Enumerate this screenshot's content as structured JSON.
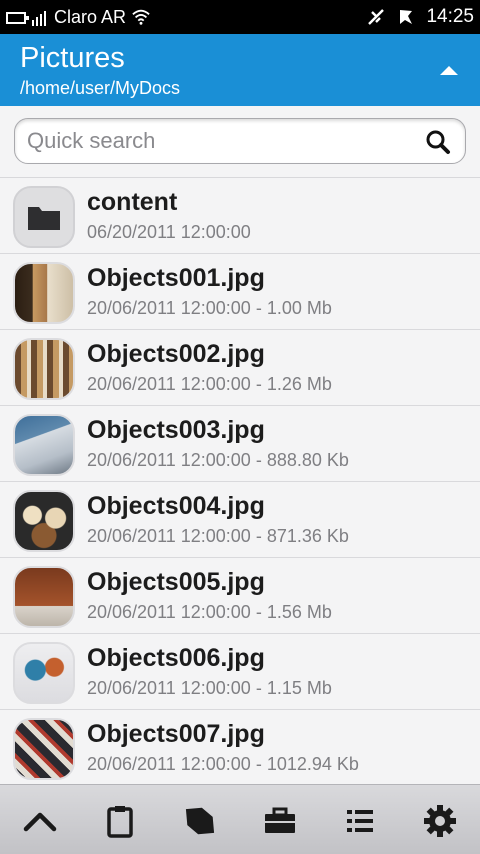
{
  "status_bar": {
    "carrier": "Claro AR",
    "time": "14:25",
    "icons": [
      "battery-icon",
      "signal-icon",
      "wifi-icon",
      "usb-icon",
      "notification-icon"
    ]
  },
  "header": {
    "title": "Pictures",
    "path": "/home/user/MyDocs",
    "accent": "#1a8fd6"
  },
  "search": {
    "placeholder": "Quick search",
    "value": ""
  },
  "files": [
    {
      "name": "content",
      "meta": "06/20/2011 12:00:00",
      "kind": "folder"
    },
    {
      "name": "Objects001.jpg",
      "meta": "20/06/2011 12:00:00 - 1.00 Mb",
      "kind": "image",
      "colors": [
        "#3a2a1c",
        "#b07a48",
        "#efe4cf"
      ]
    },
    {
      "name": "Objects002.jpg",
      "meta": "20/06/2011 12:00:00 - 1.26 Mb",
      "kind": "image",
      "colors": [
        "#6b4a2e",
        "#c59a63",
        "#e8dcc8"
      ]
    },
    {
      "name": "Objects003.jpg",
      "meta": "20/06/2011 12:00:00 - 888.80 Kb",
      "kind": "image",
      "colors": [
        "#3f6f9a",
        "#cfd6dd",
        "#7e8a95"
      ]
    },
    {
      "name": "Objects004.jpg",
      "meta": "20/06/2011 12:00:00 - 871.36 Kb",
      "kind": "image",
      "colors": [
        "#2a2a2a",
        "#e8d6b5",
        "#8a5a32"
      ]
    },
    {
      "name": "Objects005.jpg",
      "meta": "20/06/2011 12:00:00 - 1.56 Mb",
      "kind": "image",
      "colors": [
        "#7a3a1e",
        "#a4532b",
        "#d9d3ca"
      ]
    },
    {
      "name": "Objects006.jpg",
      "meta": "20/06/2011 12:00:00 - 1.15 Mb",
      "kind": "image",
      "colors": [
        "#e8e8ea",
        "#2f7fa8",
        "#c4602e"
      ]
    },
    {
      "name": "Objects007.jpg",
      "meta": "20/06/2011 12:00:00 - 1012.94 Kb",
      "kind": "image",
      "colors": [
        "#2a2a30",
        "#e2dcd2",
        "#b03a2e"
      ]
    }
  ],
  "toolbar": {
    "items": [
      "up-icon",
      "clipboard-icon",
      "bookmark-icon",
      "toolbox-icon",
      "list-icon",
      "settings-icon"
    ]
  }
}
